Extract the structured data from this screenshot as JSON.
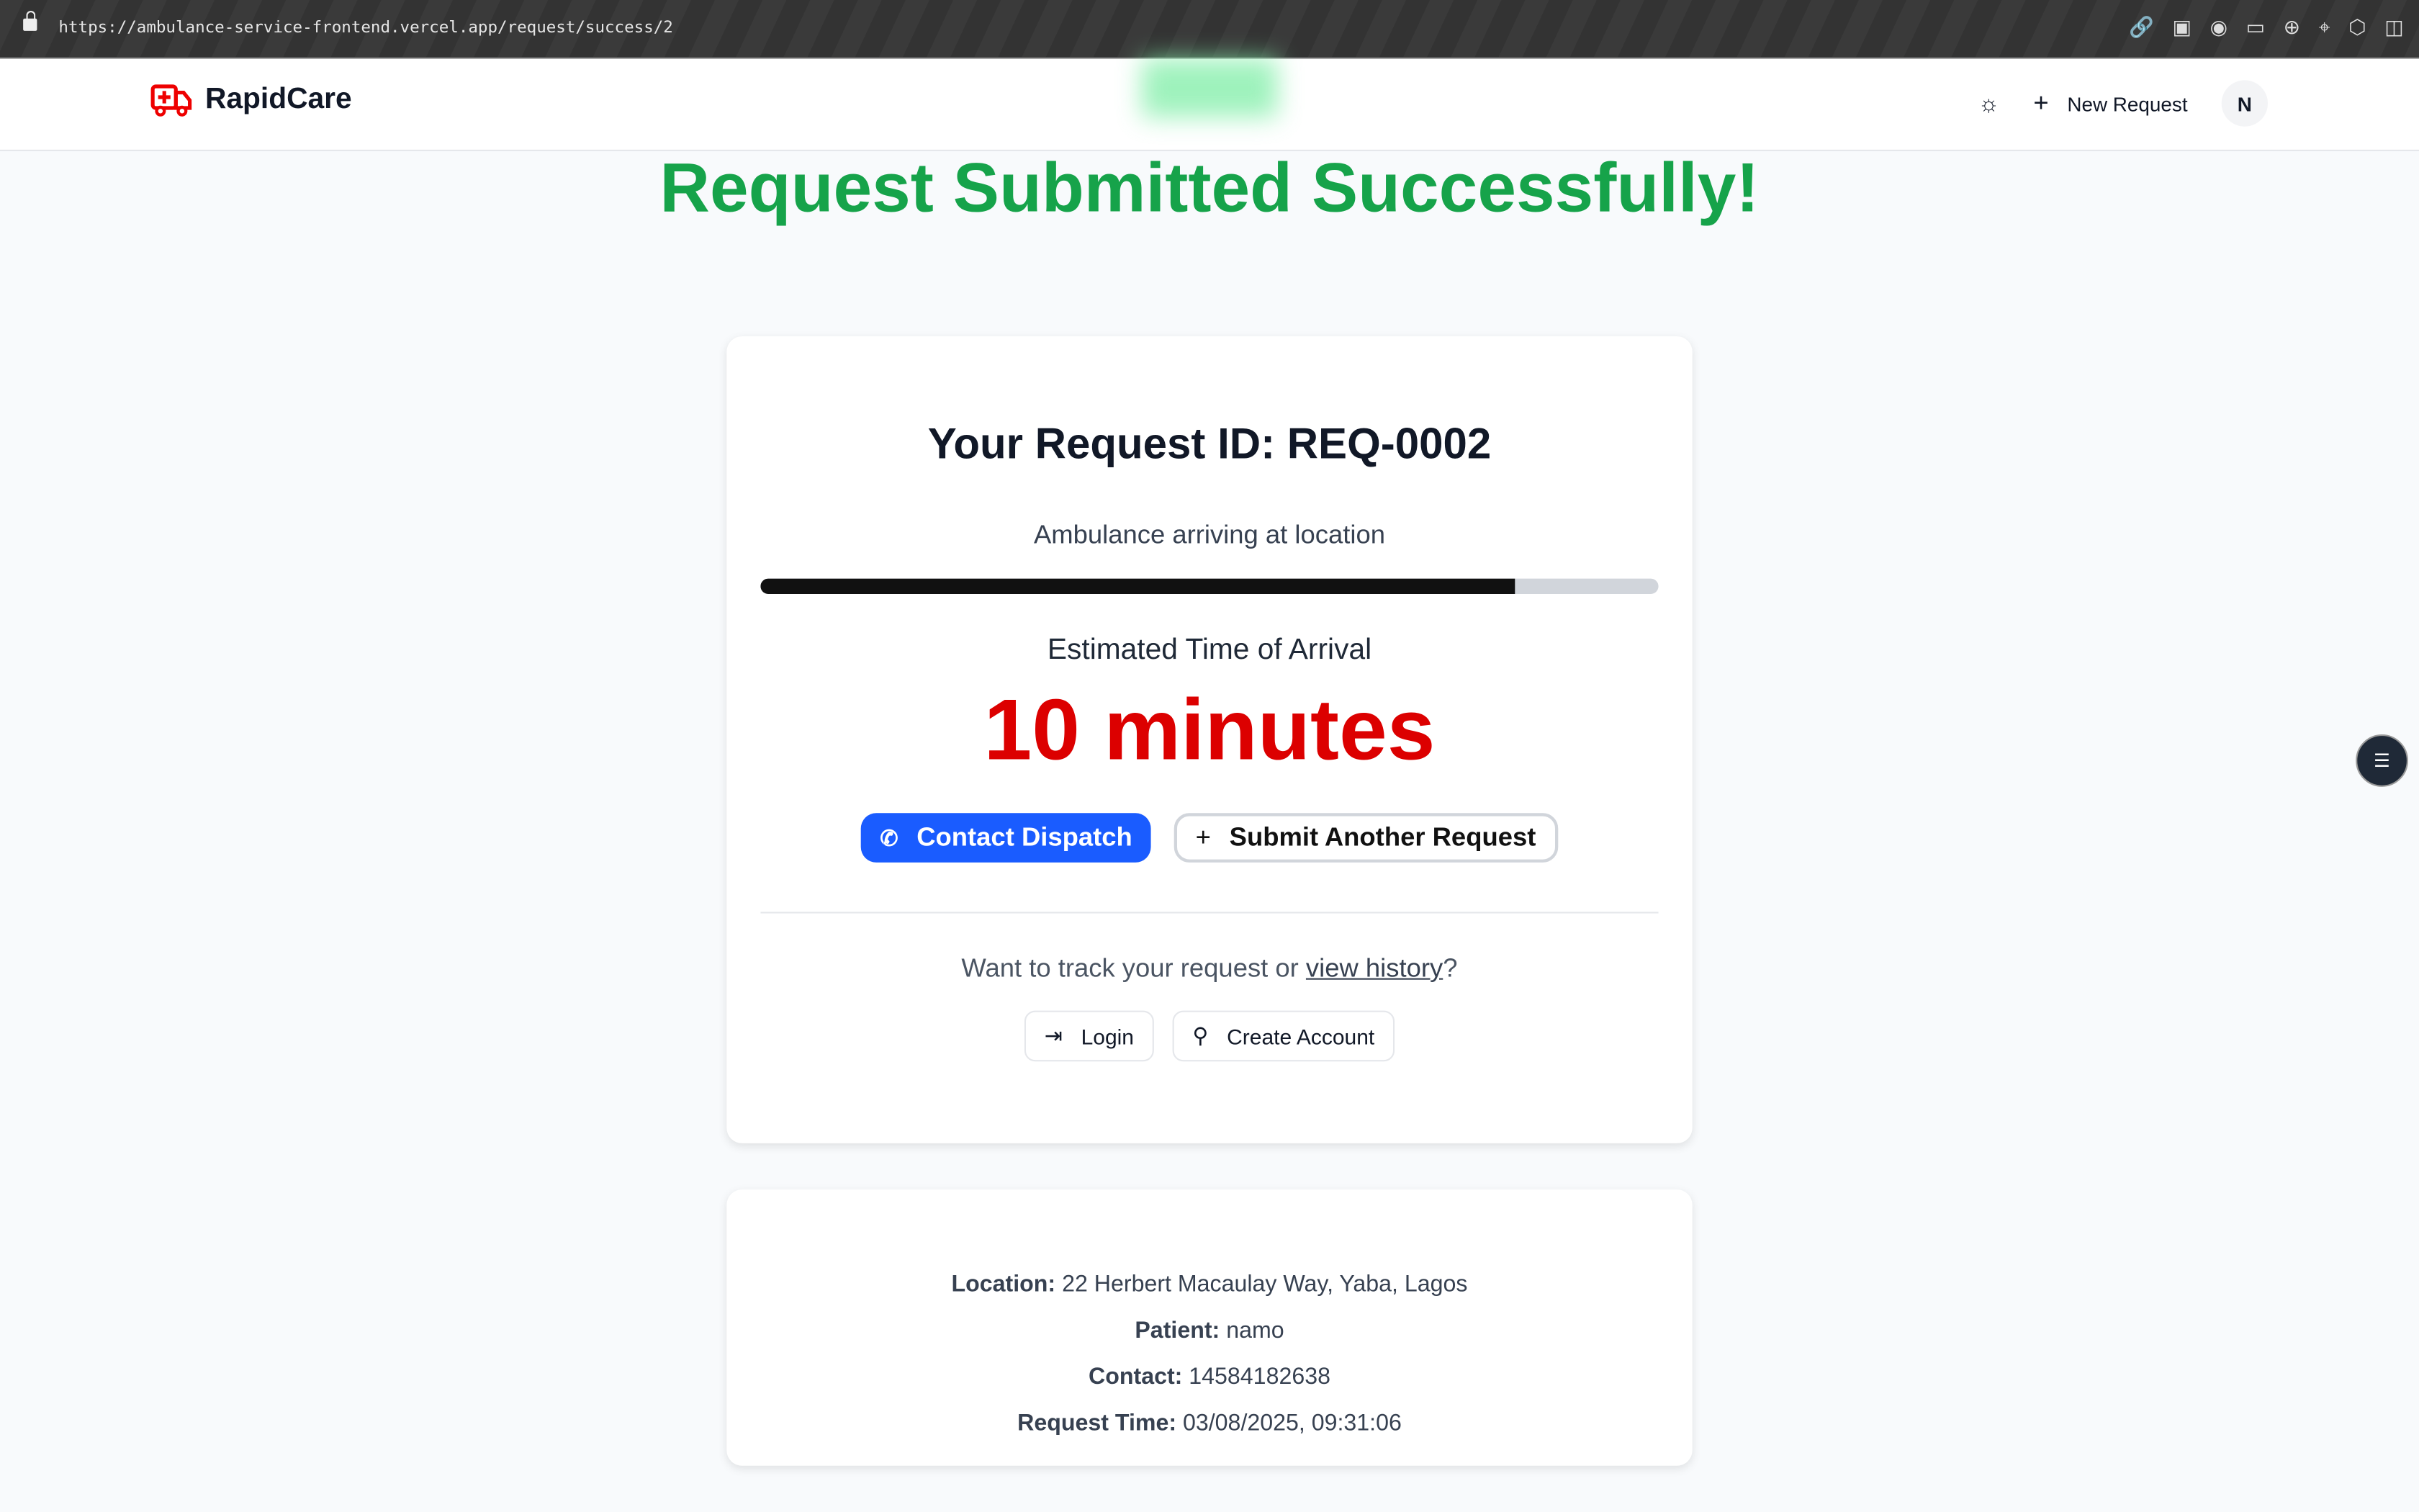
{
  "browser": {
    "url": "https://ambulance-service-frontend.vercel.app/request/success/2"
  },
  "nav": {
    "brand": "RapidCare",
    "new_request": "New Request",
    "avatar": "N"
  },
  "title": "Request Submitted Successfully!",
  "card": {
    "request_id": "Your Request ID: REQ-0002",
    "status": "Ambulance arriving at location",
    "progress_percent": 84,
    "eta_label": "Estimated Time of Arrival",
    "eta_value": "10 minutes",
    "contact_dispatch": "Contact Dispatch",
    "submit_another": "Submit Another Request",
    "track_prefix": "Want to track your request or ",
    "track_link": "view history",
    "track_suffix": "?",
    "login": "Login",
    "create_account": "Create Account"
  },
  "details": {
    "location_label": "Location:",
    "location": "22 Herbert Macaulay Way, Yaba, Lagos",
    "patient_label": "Patient:",
    "patient": "namo",
    "contact_label": "Contact:",
    "contact": "14584182638",
    "time_label": "Request Time:",
    "time": "03/08/2025, 09:31:06"
  },
  "colors": {
    "success": "#16a34a",
    "eta": "#dc0000",
    "primary": "#1a5cff"
  }
}
